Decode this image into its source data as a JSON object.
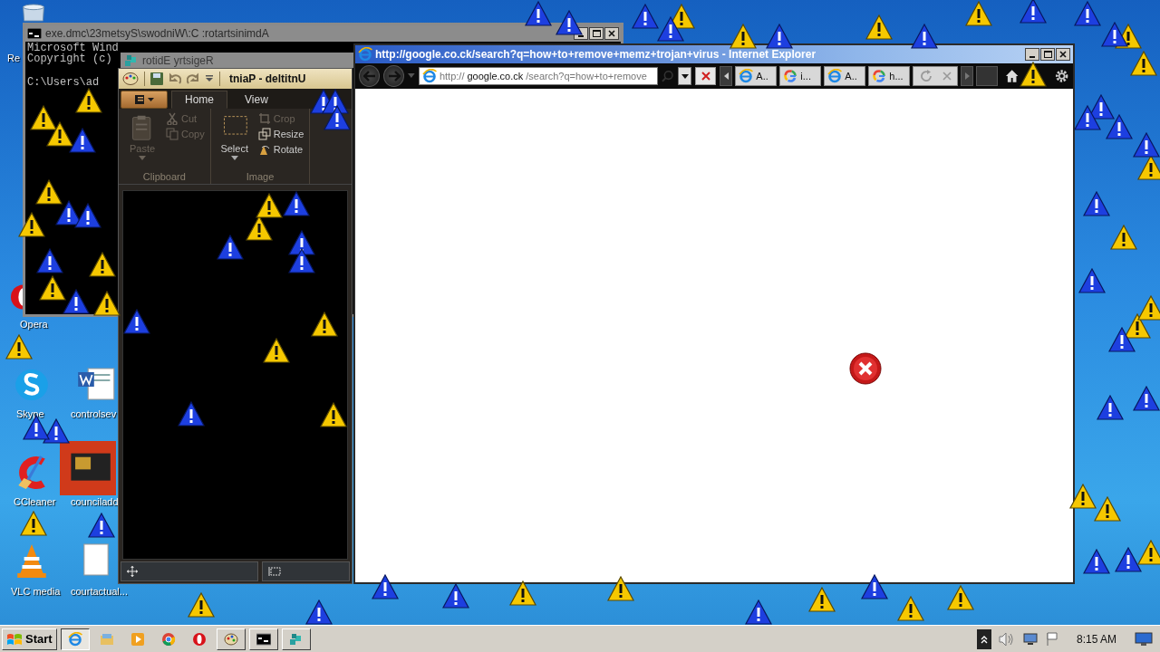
{
  "desktop": {
    "icons": [
      {
        "label": "Re",
        "kind": "recycle"
      },
      {
        "label": "Opera",
        "kind": "opera"
      },
      {
        "label": "Skype",
        "kind": "skype"
      },
      {
        "label": "controlsev",
        "kind": "word"
      },
      {
        "label": "CCleaner",
        "kind": "ccleaner"
      },
      {
        "label": "counciladd",
        "kind": "thumbnail"
      },
      {
        "label": "VLC media",
        "kind": "vlc"
      },
      {
        "label": "courtactual...",
        "kind": "file"
      }
    ]
  },
  "console_window": {
    "title": "exe.dmc\\23metsyS\\swodniW\\:C :rotartsinimdA",
    "lines": [
      "Microsoft Wind",
      "Copyright (c)",
      "C:\\Users\\ad"
    ]
  },
  "registry_window": {
    "title": "rotidE yrtsigeR"
  },
  "paint_window": {
    "title": "tniaP - deltitnU",
    "tabs": [
      {
        "label": "Home",
        "selected": true
      },
      {
        "label": "View",
        "selected": false
      }
    ],
    "groups": [
      {
        "label": "Clipboard",
        "tools": [
          {
            "label": "Paste",
            "kind": "paste",
            "disabled": true
          },
          {
            "label": "Cut",
            "kind": "cut",
            "disabled": true
          },
          {
            "label": "Copy",
            "kind": "copy",
            "disabled": true
          }
        ]
      },
      {
        "label": "Image",
        "tools": [
          {
            "label": "Select",
            "kind": "select",
            "disabled": false
          },
          {
            "label": "Crop",
            "kind": "crop",
            "disabled": true
          },
          {
            "label": "Resize",
            "kind": "resize",
            "disabled": false
          },
          {
            "label": "Rotate",
            "kind": "rotate",
            "disabled": false
          }
        ]
      }
    ]
  },
  "browser_window": {
    "title": "http://google.co.ck/search?q=how+to+remove+memz+trojan+virus - Internet Explorer",
    "address": {
      "scheme": "http://",
      "host": "google.co.ck",
      "path": "/search?q=how+to+remove"
    },
    "tabs": [
      {
        "label": "A..",
        "kind": "ie"
      },
      {
        "label": "i...",
        "kind": "google"
      },
      {
        "label": "A..",
        "kind": "ie"
      },
      {
        "label": "h...",
        "kind": "google"
      },
      {
        "kind": "loading"
      }
    ]
  },
  "taskbar": {
    "start_label": "Start",
    "items": [
      {
        "kind": "ie",
        "running": true,
        "selected": true
      },
      {
        "kind": "explorer",
        "running": false,
        "selected": false
      },
      {
        "kind": "media",
        "running": false,
        "selected": false
      },
      {
        "kind": "chrome",
        "running": false,
        "selected": false
      },
      {
        "kind": "opera",
        "running": false,
        "selected": false
      },
      {
        "kind": "paint",
        "running": true,
        "selected": false
      },
      {
        "kind": "console",
        "running": true,
        "selected": false
      },
      {
        "kind": "registry",
        "running": true,
        "selected": false
      }
    ],
    "clock": "8:15 AM"
  }
}
